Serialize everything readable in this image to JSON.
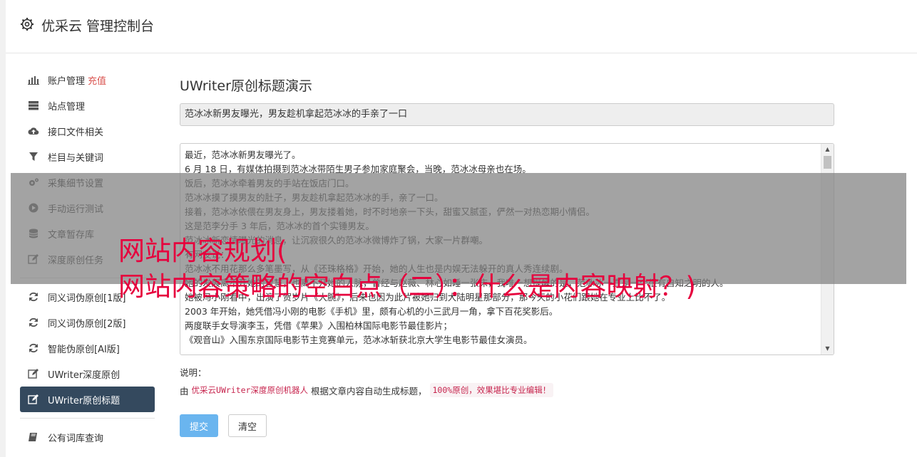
{
  "header": {
    "title": "优采云 管理控制台"
  },
  "sidebar": {
    "group1": [
      {
        "label": "账户管理",
        "extra": "充值",
        "icon": "bar-chart-icon"
      },
      {
        "label": "站点管理",
        "icon": "server-icon"
      },
      {
        "label": "接口文件相关",
        "icon": "cloud-upload-icon"
      },
      {
        "label": "栏目与关键词",
        "icon": "filter-icon"
      },
      {
        "label": "采集细节设置",
        "icon": "gears-icon"
      },
      {
        "label": "手动运行测试",
        "icon": "play-circle-icon"
      },
      {
        "label": "文章暂存库",
        "icon": "database-icon"
      },
      {
        "label": "深度原创任务",
        "icon": "edit-icon"
      }
    ],
    "group2": [
      {
        "label": "同义词伪原创[1版]",
        "icon": "refresh-icon"
      },
      {
        "label": "同义词伪原创[2版]",
        "icon": "refresh-icon"
      },
      {
        "label": "智能伪原创[AI版]",
        "icon": "refresh-icon"
      },
      {
        "label": "UWriter深度原创",
        "icon": "edit-icon"
      },
      {
        "label": "UWriter原创标题",
        "icon": "edit-icon",
        "active": true
      }
    ],
    "group3": [
      {
        "label": "公有词库查询",
        "icon": "book-icon"
      }
    ]
  },
  "main": {
    "page_title": "UWriter原创标题演示",
    "title_value": "范冰冰新男友曝光，男友趁机拿起范冰冰的手亲了一口",
    "article_lines": [
      "最近，范冰冰新男友曝光了。",
      "6 月 18 日，有媒体拍摄到范冰冰带陌生男子参加家庭聚会，当晚，范冰冰母亲也在场。",
      "饭后，范冰冰牵着男友的手站在饭店门口。",
      "范冰冰摸了摸男友的肚子，男友趁机拿起范冰冰的手，亲了一口。",
      "接着，范冰冰依偎在男友身上，男友搂着她，时不时地亲一下头，甜蜜又腻歪，俨然一对热恋期小情侣。",
      "这是范李分手 3 年后，范冰冰的首个实锤男友。",
      "范冰冰新恋情曝光的消息，让沉寂很久的范冰冰微博炸了锅，大家一片群嘲。",
      "有网友说：",
      "范冰冰不用花那么多笔墨写，从《还珠格格》开始，她的人生也是内娱无法躲开的真人秀连续剧。",
      "她的发展离不开她的智慧，也离不开她的人脉，曾经与赵薇、林心如睡一张床，我唯一想提醒的是，范冰冰一直是一个很有自知之明的人。",
      "她被冯小刚看中，出演了贺岁片《大腕》，后来也因为此片被她归到大陆明星那部分，那今天的小花们跟她在专业上比不了。",
      "2003 年开始，她凭借冯小刚的电影《手机》里，颇有心机的小三武月一角，拿下百花奖影后。",
      "两度联手女导演李玉，凭借《苹果》入围柏林国际电影节最佳影片；",
      "《观音山》入围东京国际电影节主竞赛单元，范冰冰斩获北京大学生电影节最佳女演员。"
    ],
    "note_label": "说明：",
    "note_prefix": "由",
    "note_code": "优采云UWriter深度原创机器人",
    "note_middle": "根据文章内容自动生成标题，",
    "note_badge": "100%原创，效果堪比专业编辑！",
    "submit_label": "提交",
    "clear_label": "清空"
  },
  "overlay": {
    "line1": "网站内容规划(",
    "line2": "网站内容策略的空白点（二）：什么是内容映射？)"
  },
  "colors": {
    "accent": "#34495e",
    "submit": "#6ab5ef",
    "overlay_text": "#e6003d",
    "recharge": "#d9534f"
  }
}
